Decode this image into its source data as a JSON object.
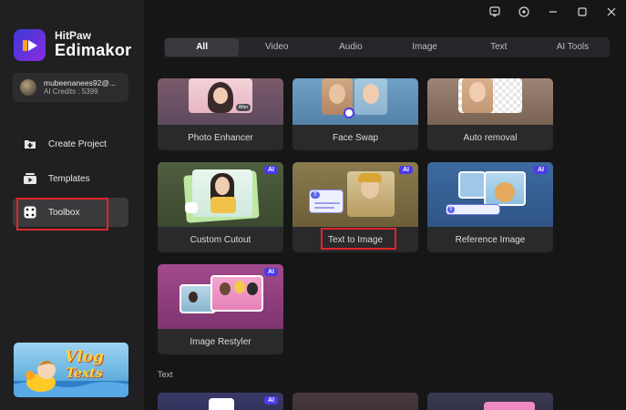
{
  "app": {
    "brand_top": "HitPaw",
    "brand_main": "Edimakor"
  },
  "user": {
    "name": "mubeenanees92@...",
    "credits": "AI Credits : 5399"
  },
  "nav": [
    {
      "label": "Create Project",
      "icon": "folder-plus-icon"
    },
    {
      "label": "Templates",
      "icon": "templates-icon"
    },
    {
      "label": "Toolbox",
      "icon": "toolbox-icon",
      "active": true
    }
  ],
  "promo": {
    "line1": "Vlog",
    "line2": "Texts"
  },
  "tabs": [
    {
      "label": "All",
      "active": true
    },
    {
      "label": "Video"
    },
    {
      "label": "Audio"
    },
    {
      "label": "Image"
    },
    {
      "label": "Text"
    },
    {
      "label": "AI Tools"
    }
  ],
  "cards": {
    "photo_enhancer": {
      "label": "Photo Enhancer",
      "badge": "After"
    },
    "face_swap": {
      "label": "Face Swap"
    },
    "auto_removal": {
      "label": "Auto removal"
    },
    "custom_cutout": {
      "label": "Custom Cutout",
      "badge": "AI"
    },
    "text_to_image": {
      "label": "Text to Image",
      "badge": "AI",
      "text_icon": "T"
    },
    "reference_image": {
      "label": "Reference Image",
      "badge": "AI",
      "text_icon": "T"
    },
    "image_restyler": {
      "label": "Image Restyler",
      "badge": "AI"
    },
    "text_row_first": {
      "badge": "AI"
    }
  },
  "section": {
    "text_label": "Text"
  },
  "colors": {
    "accent": "#4b3be8",
    "highlight": "#e0252a",
    "sidebar": "#202022",
    "background": "#161617"
  }
}
